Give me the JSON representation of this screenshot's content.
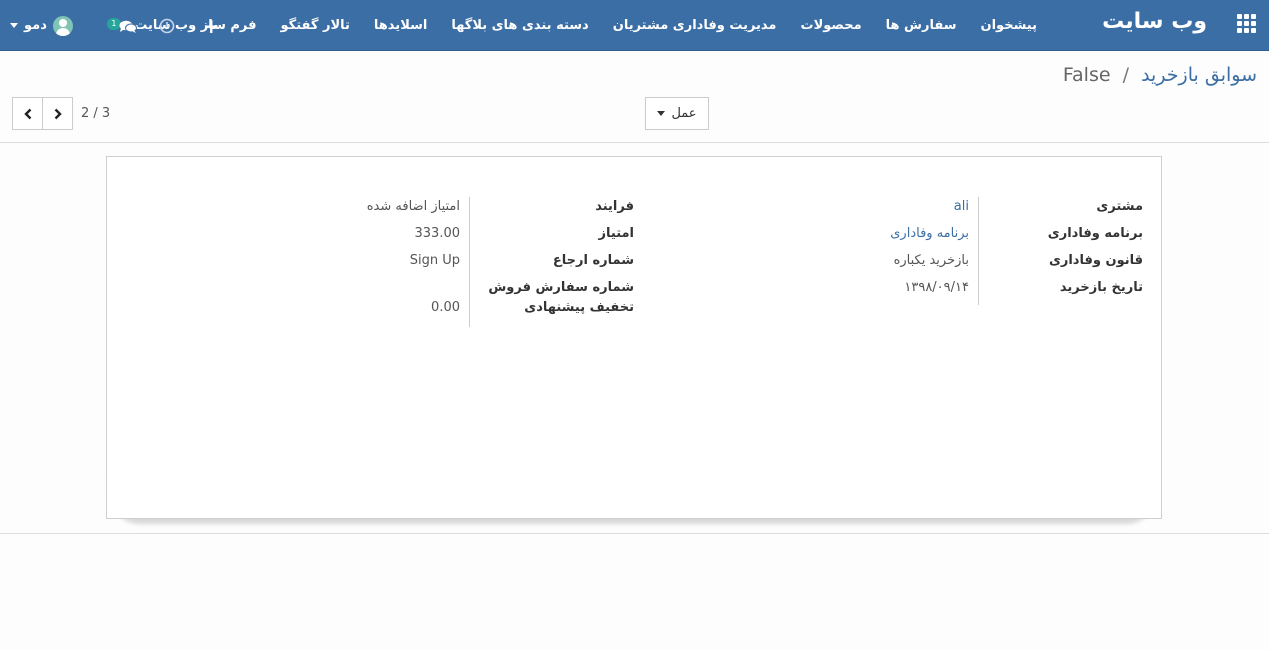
{
  "navbar": {
    "brand": "وب سایت",
    "menu": [
      "پیشخوان",
      "سفارش ها",
      "محصولات",
      "مدیریت وفاداری مشتریان",
      "دسته بندی های بلاگها",
      "اسلایدها",
      "تالار گفتگو",
      "فرم ساز وب سایت"
    ],
    "user_name": "دمو",
    "chat_count": "1",
    "plus_label": "+"
  },
  "breadcrumb": {
    "parent": "سوابق بازخرید",
    "separator": "/",
    "current": "False"
  },
  "control": {
    "action_label": "عمل",
    "pager_counter": "2 / 3"
  },
  "form": {
    "right": [
      {
        "label": "مشتری",
        "value": "ali",
        "link": true
      },
      {
        "label": "برنامه وفاداری",
        "value": "برنامه وفاداری",
        "link": true
      },
      {
        "label": "قانون وفاداری",
        "value": "بازخرید یکباره",
        "link": false
      },
      {
        "label": "تاریخ بازخرید",
        "value": "۱۳۹۸/۰۹/۱۴",
        "link": false
      }
    ],
    "left": [
      {
        "label": "فرایند",
        "value": "امتیاز اضافه شده"
      },
      {
        "label": "امتیاز",
        "value": "333.00"
      },
      {
        "label": "شماره ارجاع",
        "value": "Sign Up"
      },
      {
        "label": "شماره سفارش فروش تخفیف پیشنهادی",
        "value": "0.00"
      }
    ]
  },
  "colors": {
    "navbar": "#3b6ea5",
    "link": "#3b6ea5",
    "badge": "#26a69a"
  }
}
